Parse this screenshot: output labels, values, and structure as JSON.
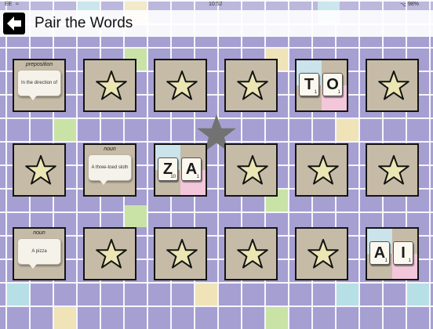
{
  "status_bar": {
    "carrier": "EE",
    "time": "10:52",
    "battery": "98%"
  },
  "header": {
    "title": "Pair the Words",
    "back_icon": "back-arrow-icon"
  },
  "colors": {
    "board_lavender": "#a69fd2",
    "card_face": "#c6bba7",
    "star_fill": "#ebe6b3",
    "tile_blue": "#cbe3ea",
    "tile_pink": "#f3c6d9"
  },
  "cards": [
    {
      "type": "definition",
      "part_of_speech": "preposition",
      "definition": "In the direction of"
    },
    {
      "type": "hidden"
    },
    {
      "type": "hidden"
    },
    {
      "type": "hidden"
    },
    {
      "type": "tiles",
      "letters": [
        "T",
        "O"
      ],
      "points": [
        "1",
        "1"
      ]
    },
    {
      "type": "hidden"
    },
    {
      "type": "hidden"
    },
    {
      "type": "definition",
      "part_of_speech": "noun",
      "definition": "A three-toed sloth"
    },
    {
      "type": "tiles",
      "letters": [
        "Z",
        "A"
      ],
      "points": [
        "10",
        "1"
      ]
    },
    {
      "type": "hidden"
    },
    {
      "type": "hidden"
    },
    {
      "type": "hidden"
    },
    {
      "type": "definition",
      "part_of_speech": "noun",
      "definition": "A pizza"
    },
    {
      "type": "hidden"
    },
    {
      "type": "hidden"
    },
    {
      "type": "hidden"
    },
    {
      "type": "hidden"
    },
    {
      "type": "tiles",
      "letters": [
        "A",
        "I"
      ],
      "points": [
        "1",
        "1"
      ]
    }
  ]
}
